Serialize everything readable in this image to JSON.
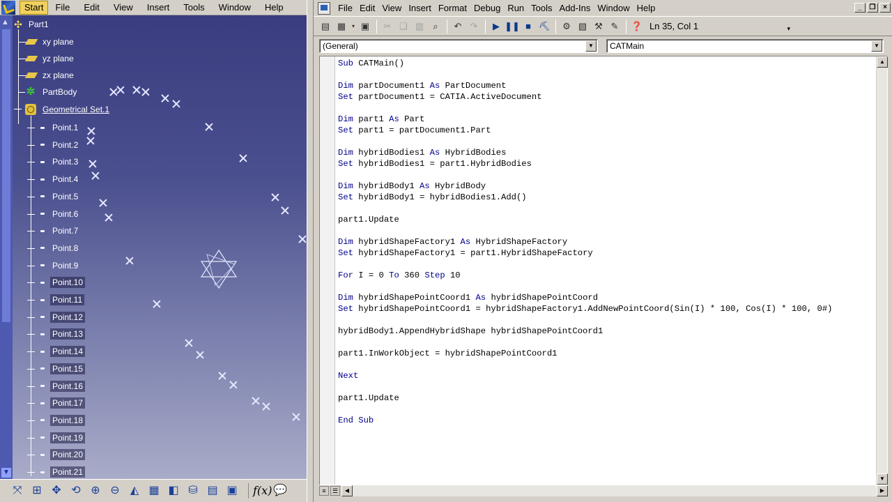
{
  "catia": {
    "menu": [
      "Start",
      "File",
      "Edit",
      "View",
      "Insert",
      "Tools",
      "Window",
      "Help"
    ],
    "tree": {
      "root": "Part1",
      "planes": [
        "xy plane",
        "yz plane",
        "zx plane"
      ],
      "part_body": "PartBody",
      "geometrical_set": "Geometrical Set.1",
      "points": [
        "Point.1",
        "Point.2",
        "Point.3",
        "Point.4",
        "Point.5",
        "Point.6",
        "Point.7",
        "Point.8",
        "Point.9",
        "Point.10",
        "Point.11",
        "Point.12",
        "Point.13",
        "Point.14",
        "Point.15",
        "Point.16",
        "Point.17",
        "Point.18",
        "Point.19",
        "Point.20",
        "Point.21"
      ]
    },
    "toolbar_icons": [
      "fit-all-icon",
      "pan-icon",
      "rotate-icon",
      "zoom-in-icon",
      "zoom-out-icon",
      "normal-view-icon",
      "iso-view-icon",
      "shading-icon",
      "hide-show-icon",
      "swap-space-icon",
      "formula-icon",
      "comment-icon"
    ]
  },
  "vba": {
    "menu": [
      "File",
      "Edit",
      "View",
      "Insert",
      "Format",
      "Debug",
      "Run",
      "Tools",
      "Add-Ins",
      "Window",
      "Help"
    ],
    "status": "Ln 35, Col 1",
    "object_combo": "(General)",
    "procedure_combo": "CATMain",
    "code_lines": [
      "Sub CATMain()",
      "",
      "Dim partDocument1 As PartDocument",
      "Set partDocument1 = CATIA.ActiveDocument",
      "",
      "Dim part1 As Part",
      "Set part1 = partDocument1.Part",
      "",
      "Dim hybridBodies1 As HybridBodies",
      "Set hybridBodies1 = part1.HybridBodies",
      "",
      "Dim hybridBody1 As HybridBody",
      "Set hybridBody1 = hybridBodies1.Add()",
      "",
      "part1.Update",
      "",
      "Dim hybridShapeFactory1 As HybridShapeFactory",
      "Set hybridShapeFactory1 = part1.HybridShapeFactory",
      "",
      "For I = 0 To 360 Step 10",
      "",
      "Dim hybridShapePointCoord1 As hybridShapePointCoord",
      "Set hybridShapePointCoord1 = hybridShapeFactory1.AddNewPointCoord(Sin(I) * 100, Cos(I) * 100, 0#)",
      "",
      "hybridBody1.AppendHybridShape hybridShapePointCoord1",
      "",
      "part1.InWorkObject = hybridShapePointCoord1",
      "",
      "Next",
      "",
      "part1.Update",
      "",
      "End Sub"
    ]
  },
  "colors": {
    "viewport_top": "#3a3d7f",
    "viewport_bottom": "#a9acc8",
    "keyword": "#00008b"
  }
}
